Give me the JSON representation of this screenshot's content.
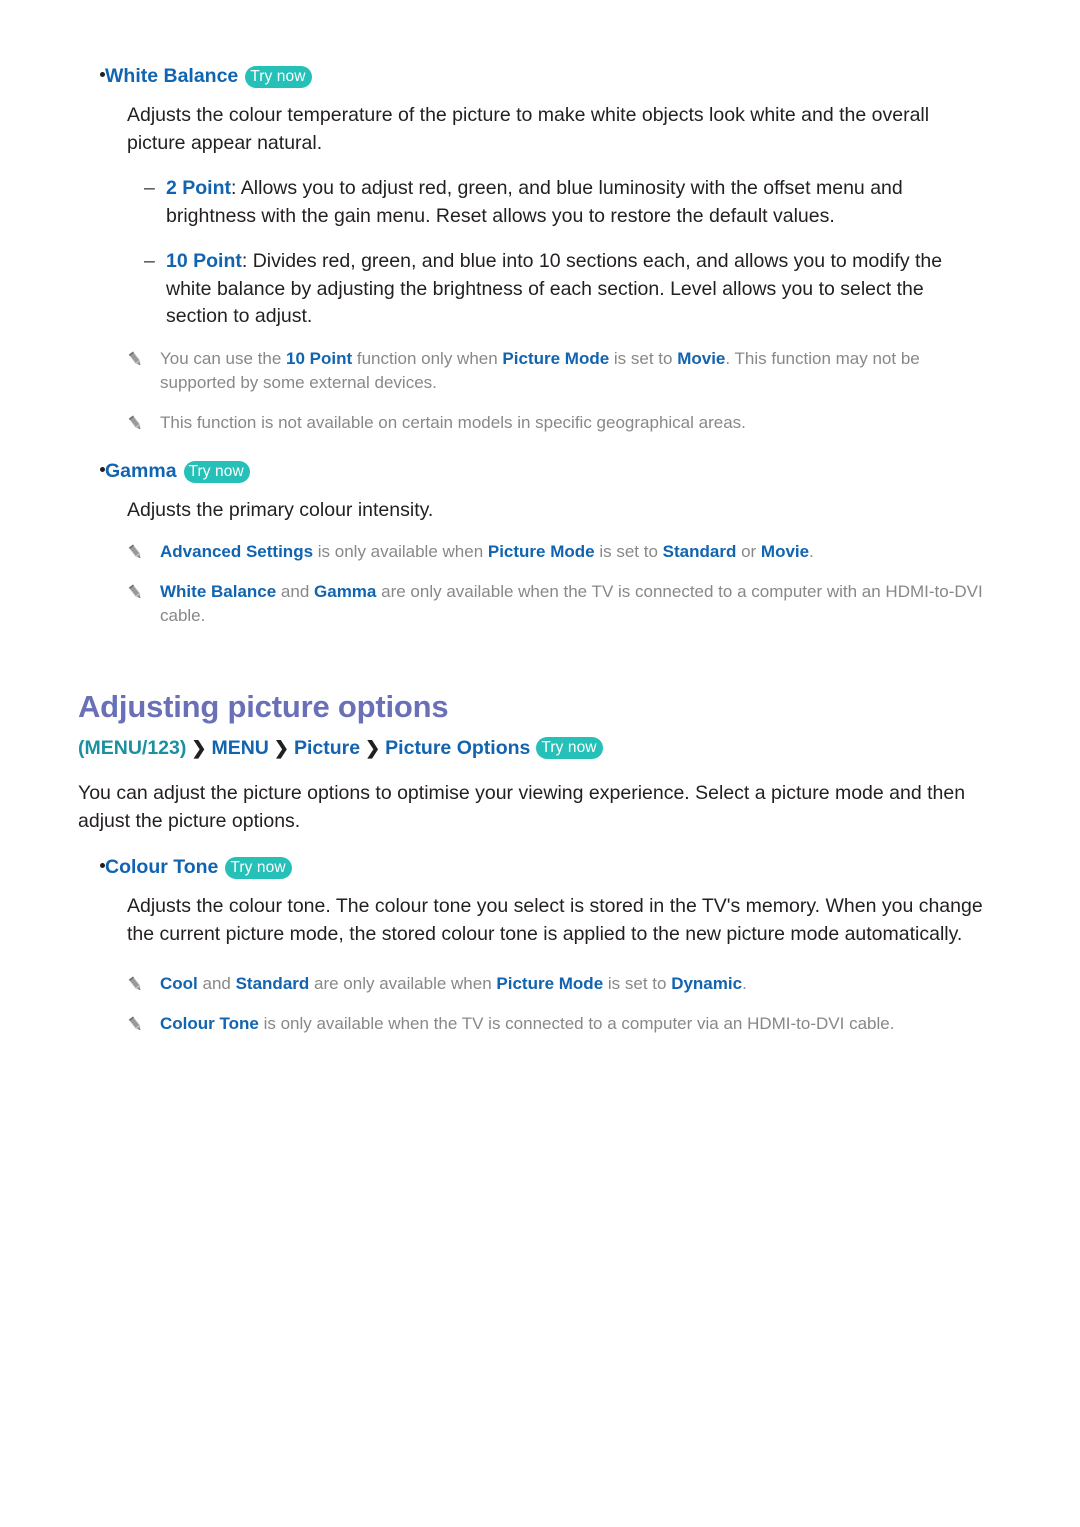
{
  "icons": {
    "note": "pencil-icon",
    "bullet": "bullet-dot-icon",
    "dash": "dash-marker-icon",
    "chevron": "chevron-right-icon"
  },
  "colors": {
    "heading_blue": "#1264b0",
    "section_purple": "#6a70b7",
    "trynow_teal": "#25c0b7",
    "note_grey": "#888888",
    "breadcrumb_teal": "#1c8fa0",
    "body_black": "#231f20"
  },
  "labels": {
    "try_now": "Try now",
    "dash": "–",
    "chevron": "❯"
  },
  "white_balance": {
    "title": "White Balance",
    "description": "Adjusts the colour temperature of the picture to make white objects look white and the overall picture appear natural.",
    "items": [
      {
        "term": "2 Point",
        "colon": ":",
        "text": " Allows you to adjust red, green, and blue luminosity with the offset menu and brightness with the gain menu. Reset allows you to restore the default values."
      },
      {
        "term": "10 Point",
        "colon": ":",
        "text": " Divides red, green, and blue into 10 sections each, and allows you to modify the white balance by adjusting the brightness of each section. Level allows you to select the section to adjust."
      }
    ],
    "notes": [
      {
        "p1": "You can use the ",
        "k1": "10 Point",
        "p2": " function only when ",
        "k2": "Picture Mode",
        "p3": " is set to ",
        "k3": "Movie",
        "p4": ". This function may not be supported by some external devices."
      },
      {
        "p1": "This function is not available on certain models in specific geographical areas."
      }
    ]
  },
  "gamma": {
    "title": "Gamma",
    "description": "Adjusts the primary colour intensity.",
    "notes": [
      {
        "k1": "Advanced Settings",
        "p2": " is only available when ",
        "k2": "Picture Mode",
        "p3": " is set to ",
        "k3": "Standard",
        "p4": " or ",
        "k4": "Movie",
        "p5": "."
      },
      {
        "k1": "White Balance",
        "p2": " and ",
        "k2": "Gamma",
        "p3": " are only available when the TV is connected to a computer with an HDMI-to-DVI cable."
      }
    ]
  },
  "section": {
    "heading": "Adjusting picture options",
    "breadcrumb": {
      "menu123": "(MENU/123)",
      "items": [
        "MENU",
        "Picture",
        "Picture Options"
      ]
    },
    "intro": "You can adjust the picture options to optimise your viewing experience. Select a picture mode and then adjust the picture options."
  },
  "colour_tone": {
    "title": "Colour Tone",
    "description": "Adjusts the colour tone. The colour tone you select is stored in the TV's memory. When you change the current picture mode, the stored colour tone is applied to the new picture mode automatically.",
    "notes": [
      {
        "k1": "Cool",
        "p2": " and ",
        "k2": "Standard",
        "p3": " are only available when ",
        "k3": "Picture Mode",
        "p4": " is set to ",
        "k4": "Dynamic",
        "p5": "."
      },
      {
        "k1": "Colour Tone",
        "p2": " is only available when the TV is connected to a computer via an HDMI-to-DVI cable."
      }
    ]
  }
}
